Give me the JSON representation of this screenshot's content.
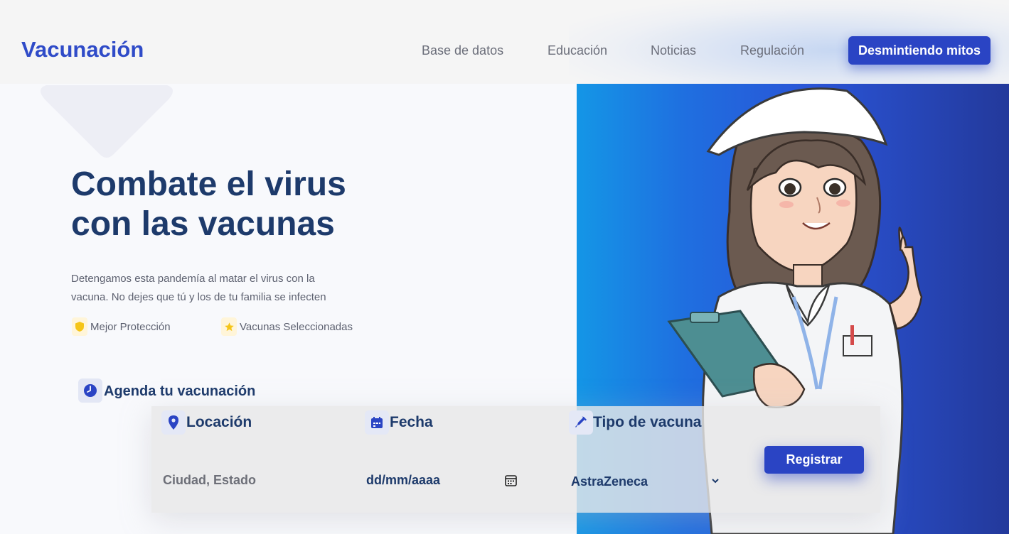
{
  "header": {
    "brand": "Vacunación",
    "nav": [
      "Base de datos",
      "Educación",
      "Noticias",
      "Regulación"
    ],
    "cta_label": "Desmintiendo mitos"
  },
  "hero": {
    "title_line1": "Combate el virus",
    "title_line2": "con las vacunas",
    "description_line1": "Detengamos esta pandemía al matar el virus con la",
    "description_line2": "vacuna. No dejes que tú y los de tu familia se infecten",
    "features": [
      {
        "icon": "shield-icon",
        "label": "Mejor Protección"
      },
      {
        "icon": "star-icon",
        "label": "Vacunas Seleccionadas"
      }
    ]
  },
  "schedule": {
    "title": "Agenda tu vacunación",
    "location_label": "Locación",
    "location_placeholder": "Ciudad, Estado",
    "date_label": "Fecha",
    "date_placeholder": "dd/mm/aaaa",
    "vaccine_label": "Tipo de vacuna",
    "vaccine_selected": "AstraZeneca",
    "submit_label": "Registrar"
  },
  "colors": {
    "accent": "#2a44c4",
    "heading": "#1d3a6b",
    "feature_icon": "#f5c518"
  }
}
